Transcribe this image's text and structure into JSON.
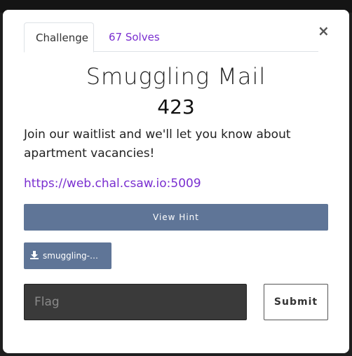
{
  "tabs": {
    "challenge_label": "Challenge",
    "solves_label": "67 Solves"
  },
  "close_glyph": "×",
  "challenge": {
    "name": "Smuggling Mail",
    "points": "423",
    "description": "Join our waitlist and we'll let you know about apartment vacancies!",
    "link": "https://web.chal.csaw.io:5009"
  },
  "hint_button_label": "View Hint",
  "file_button": {
    "label": "smuggling-m...",
    "icon": "download-icon"
  },
  "flag_input": {
    "placeholder": "Flag",
    "value": ""
  },
  "submit_label": "Submit",
  "colors": {
    "accent": "#7a2fd0",
    "button": "#5f7597",
    "input_bg": "#3a3a3a"
  }
}
